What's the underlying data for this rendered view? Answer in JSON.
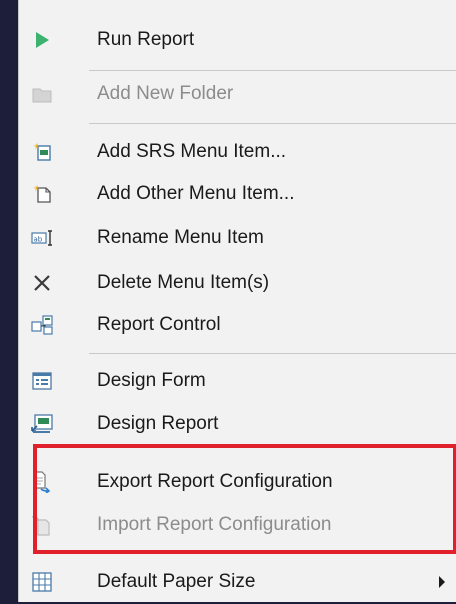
{
  "menu": {
    "items": [
      {
        "label": "Run Report",
        "icon": "play-icon",
        "enabled": true
      },
      {
        "label": "Add New Folder",
        "icon": "folder-icon",
        "enabled": false
      },
      {
        "label": "Add SRS Menu Item...",
        "icon": "add-srs-item-icon",
        "enabled": true
      },
      {
        "label": "Add Other Menu Item...",
        "icon": "add-other-item-icon",
        "enabled": true
      },
      {
        "label": "Rename Menu Item",
        "icon": "rename-icon",
        "enabled": true
      },
      {
        "label": "Delete Menu Item(s)",
        "icon": "delete-x-icon",
        "enabled": true
      },
      {
        "label": "Report Control",
        "icon": "report-control-icon",
        "enabled": true
      },
      {
        "label": "Design Form",
        "icon": "design-form-icon",
        "enabled": true
      },
      {
        "label": "Design Report",
        "icon": "design-report-icon",
        "enabled": true
      },
      {
        "label": "Export Report Configuration",
        "icon": "export-icon",
        "enabled": true
      },
      {
        "label": "Import Report Configuration",
        "icon": "import-icon",
        "enabled": false
      },
      {
        "label": "Default Paper Size",
        "icon": "paper-size-icon",
        "enabled": true,
        "has_submenu": true
      }
    ]
  },
  "colors": {
    "background": "#1d1f3a",
    "menu_bg": "#f2f2f2",
    "highlight": "#e0202b",
    "play_green": "#3cb371"
  }
}
